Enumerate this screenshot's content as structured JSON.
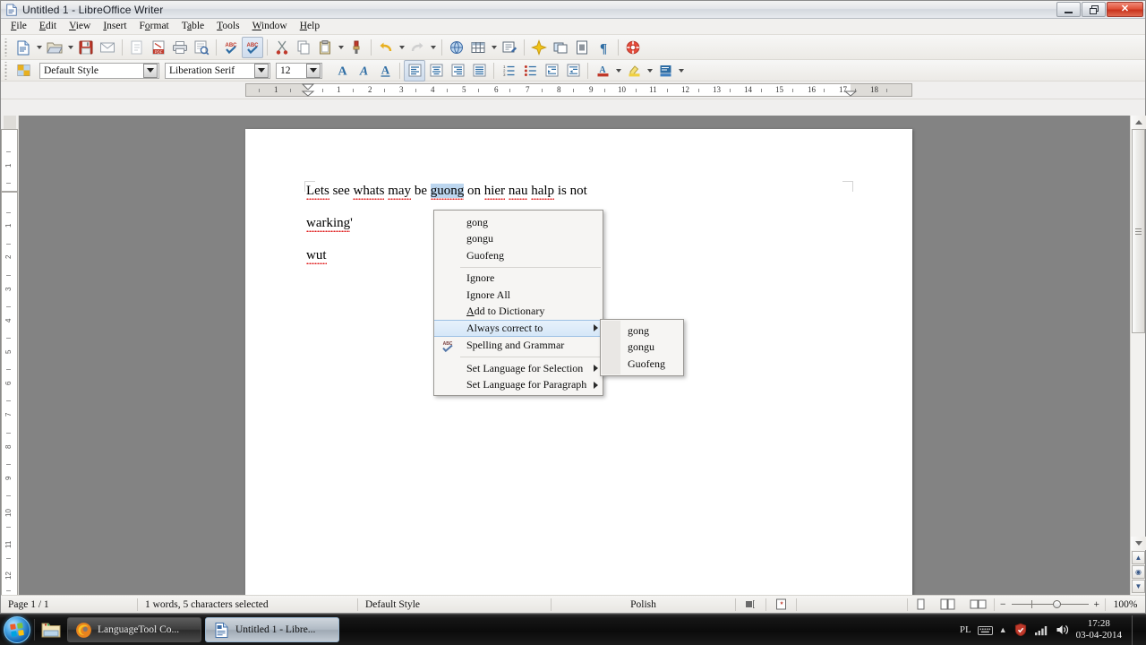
{
  "window": {
    "title": "Untitled 1 - LibreOffice Writer",
    "app_icon": "writer-document-icon",
    "minimize_label": "—",
    "maximize_label": "❐",
    "close_label": "✕"
  },
  "menubar": {
    "items": [
      {
        "label": "File",
        "mnemonic": "F"
      },
      {
        "label": "Edit",
        "mnemonic": "E"
      },
      {
        "label": "View",
        "mnemonic": "V"
      },
      {
        "label": "Insert",
        "mnemonic": "I"
      },
      {
        "label": "Format",
        "mnemonic": "o"
      },
      {
        "label": "Table",
        "mnemonic": "a"
      },
      {
        "label": "Tools",
        "mnemonic": "T"
      },
      {
        "label": "Window",
        "mnemonic": "W"
      },
      {
        "label": "Help",
        "mnemonic": "H"
      }
    ]
  },
  "standard_toolbar": {
    "buttons": [
      {
        "name": "new-document",
        "icon": "new-doc-icon"
      },
      {
        "name": "open-document",
        "icon": "open-folder-icon"
      },
      {
        "name": "save-document",
        "icon": "save-floppy-icon"
      },
      {
        "name": "email-document",
        "icon": "envelope-icon"
      },
      {
        "name": "edit-file",
        "icon": "edit-file-icon"
      },
      {
        "name": "export-pdf",
        "icon": "pdf-icon"
      },
      {
        "name": "print-file",
        "icon": "printer-icon"
      },
      {
        "name": "print-preview",
        "icon": "print-preview-icon"
      },
      {
        "name": "spelling",
        "icon": "abc-check-icon"
      },
      {
        "name": "autospellcheck",
        "icon": "abc-autocheck-icon"
      },
      {
        "name": "cut",
        "icon": "scissors-icon"
      },
      {
        "name": "copy",
        "icon": "copy-icon"
      },
      {
        "name": "paste",
        "icon": "clipboard-icon"
      },
      {
        "name": "clone-formatting",
        "icon": "paintbrush-icon"
      },
      {
        "name": "undo",
        "icon": "undo-arrow-icon"
      },
      {
        "name": "redo",
        "icon": "redo-arrow-icon"
      },
      {
        "name": "insert-hyperlink",
        "icon": "globe-icon"
      },
      {
        "name": "insert-table",
        "icon": "table-grid-icon"
      },
      {
        "name": "insert-text-box",
        "icon": "text-box-icon"
      },
      {
        "name": "insert-special-character",
        "icon": "star-icon"
      },
      {
        "name": "insert-frame",
        "icon": "frame-icon"
      },
      {
        "name": "insert-field",
        "icon": "field-icon"
      },
      {
        "name": "formatting-marks",
        "icon": "pilcrow-icon"
      },
      {
        "name": "help",
        "icon": "lifebuoy-icon"
      }
    ]
  },
  "formatting_toolbar": {
    "styles_button": "paragraph-style-icon",
    "paragraph_style": {
      "value": "Default Style",
      "placeholder": "Paragraph Style"
    },
    "font_name": {
      "value": "Liberation Serif",
      "placeholder": "Font Name"
    },
    "font_size": {
      "value": "12",
      "placeholder": "Font Size"
    },
    "buttons": [
      {
        "name": "bold",
        "icon": "bold-a-icon"
      },
      {
        "name": "italic",
        "icon": "italic-a-icon"
      },
      {
        "name": "underline",
        "icon": "underline-a-icon"
      },
      {
        "name": "align-left",
        "icon": "align-left-icon",
        "active": true
      },
      {
        "name": "align-center",
        "icon": "align-center-icon",
        "active": false
      },
      {
        "name": "align-right",
        "icon": "align-right-icon",
        "active": false
      },
      {
        "name": "align-justified",
        "icon": "align-justify-icon",
        "active": false
      },
      {
        "name": "ordered-list",
        "icon": "numbered-list-icon"
      },
      {
        "name": "unordered-list",
        "icon": "bullet-list-icon"
      },
      {
        "name": "decrease-indent",
        "icon": "decrease-indent-icon"
      },
      {
        "name": "increase-indent",
        "icon": "increase-indent-icon"
      },
      {
        "name": "font-color",
        "icon": "font-color-icon"
      },
      {
        "name": "highlighting-color",
        "icon": "highlight-icon"
      },
      {
        "name": "background-color",
        "icon": "background-color-icon"
      }
    ]
  },
  "ruler": {
    "horizontal_ticks": [
      "1",
      "1",
      "2",
      "3",
      "4",
      "5",
      "6",
      "7",
      "8",
      "9",
      "10",
      "11",
      "12",
      "13",
      "14",
      "15",
      "16",
      "17",
      "18"
    ],
    "vertical_ticks": [
      "1",
      "1",
      "2",
      "3",
      "4",
      "5",
      "6",
      "7",
      "8",
      "9",
      "10",
      "11",
      "12"
    ],
    "unit": "inch"
  },
  "document": {
    "line1_pre": "Lets see whats may be ",
    "line1_selected": "guong",
    "line1_post_a": " on ",
    "line1_hier": "hier",
    "line1_sp1": " ",
    "line1_nau": "nau",
    "line1_sp2": " ",
    "line1_halp": "halp",
    "line1_end": " is not",
    "line2": "warking'",
    "line3": "wut",
    "misspelled": [
      "Lets",
      "whats",
      "may",
      "guong",
      "hier",
      "nau",
      "halp",
      "warking",
      "wut"
    ]
  },
  "context_menu": {
    "suggestions": [
      "gong",
      "gongu",
      "Guofeng"
    ],
    "actions": [
      {
        "label": "Ignore",
        "mnemonic": ""
      },
      {
        "label": "Ignore All",
        "mnemonic": ""
      },
      {
        "label": "Add to Dictionary",
        "mnemonic": "A"
      }
    ],
    "always_correct_to": {
      "label": "Always correct to",
      "highlighted": true,
      "has_submenu": true
    },
    "spelling_and_grammar": {
      "label": "Spelling and Grammar",
      "icon": "abc-check-icon"
    },
    "language_items": [
      {
        "label": "Set Language for Selection",
        "has_submenu": true
      },
      {
        "label": "Set Language for Paragraph",
        "has_submenu": true
      }
    ],
    "submenu": {
      "items": [
        "gong",
        "gongu",
        "Guofeng"
      ]
    },
    "highlight_color": "#d6e7f8"
  },
  "statusbar": {
    "page": "Page 1 / 1",
    "selection": "1 words, 5 characters selected",
    "page_style": "Default Style",
    "language": "Polish",
    "insert_mode_icon": "insert-mode-icon",
    "selection_mode_icon": "selection-mode-icon",
    "unsaved_icon": "unsaved-changes-icon",
    "view_layouts": [
      {
        "name": "single-page-view",
        "icon": "single-page-icon"
      },
      {
        "name": "multi-page-view",
        "icon": "multi-page-icon"
      },
      {
        "name": "book-view",
        "icon": "book-view-icon"
      }
    ],
    "zoom_out": "−",
    "zoom_in": "+",
    "zoom_level": "100%"
  },
  "taskbar": {
    "start_label": "Start",
    "quick_launch": [
      {
        "name": "explorer-icon",
        "label": "Windows Explorer"
      }
    ],
    "tasks": [
      {
        "label": "LanguageTool Co...",
        "icon": "firefox-icon",
        "active": false
      },
      {
        "label": "Untitled 1 - Libre...",
        "icon": "writer-document-icon",
        "active": true
      }
    ],
    "tray": {
      "language": "PL",
      "keyboard_icon": "keyboard-icon",
      "show_hidden_icon": "chevron-up-icon",
      "antivirus_icon": "antivirus-icon",
      "network_icon": "network-signal-icon",
      "volume_icon": "speaker-icon",
      "time": "17:28",
      "date": "03-04-2014"
    }
  }
}
